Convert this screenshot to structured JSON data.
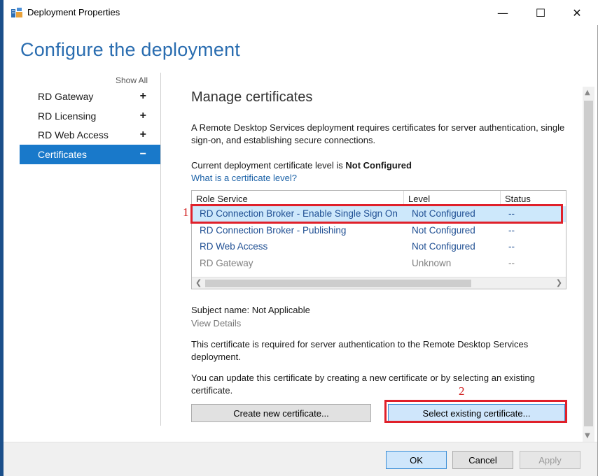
{
  "window": {
    "title": "Deployment Properties",
    "minimize_glyph": "—",
    "maximize_glyph": "☐",
    "close_glyph": "✕"
  },
  "page_title": "Configure the deployment",
  "nav": {
    "show_all": "Show All",
    "items": [
      {
        "label": "RD Gateway",
        "toggle": "+",
        "selected": false
      },
      {
        "label": "RD Licensing",
        "toggle": "+",
        "selected": false
      },
      {
        "label": "RD Web Access",
        "toggle": "+",
        "selected": false
      },
      {
        "label": "Certificates",
        "toggle": "−",
        "selected": true
      }
    ]
  },
  "content": {
    "section_title": "Manage certificates",
    "intro": "A Remote Desktop Services deployment requires certificates for server authentication, single sign-on, and establishing secure connections.",
    "level_prefix": "Current deployment certificate level is ",
    "level_value": "Not Configured",
    "level_link": "What is a certificate level?",
    "table": {
      "columns": [
        "Role Service",
        "Level",
        "Status"
      ],
      "rows": [
        {
          "role": "RD Connection Broker - Enable Single Sign On",
          "level": "Not Configured",
          "status": "--",
          "selected": true
        },
        {
          "role": "RD Connection Broker - Publishing",
          "level": "Not Configured",
          "status": "--",
          "selected": false
        },
        {
          "role": "RD Web Access",
          "level": "Not Configured",
          "status": "--",
          "selected": false
        },
        {
          "role": "RD Gateway",
          "level": "Unknown",
          "status": "--",
          "selected": false
        }
      ]
    },
    "subject_name": "Subject name: Not Applicable",
    "view_details": "View Details",
    "required_text": "This certificate is required for server authentication to the Remote Desktop Services deployment.",
    "update_text": "You can update this certificate by creating a new certificate or by selecting an existing certificate.",
    "create_button": "Create new certificate...",
    "select_button": "Select existing certificate..."
  },
  "footer": {
    "ok": "OK",
    "cancel": "Cancel",
    "apply": "Apply"
  },
  "annotations": [
    "1",
    "2"
  ],
  "colors": {
    "accent": "#1979ca",
    "heading": "#2a6db0",
    "annotation": "#e0202a"
  }
}
